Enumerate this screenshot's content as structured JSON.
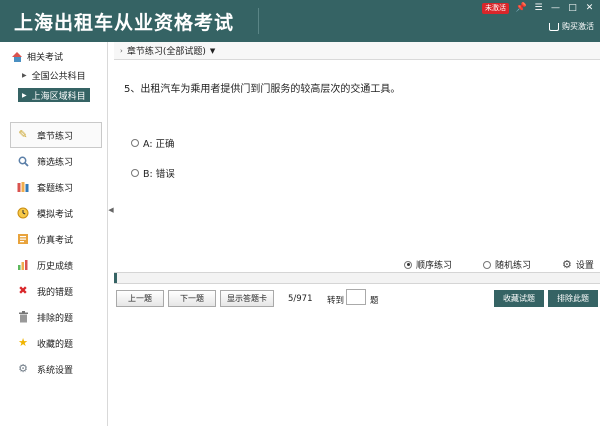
{
  "window": {
    "title": "上海出租车从业资格考试",
    "activate_badge": "未激活",
    "controls": {
      "pin": "📌",
      "menu": "☰",
      "minimize": "—",
      "maximize": "□",
      "close": "✕"
    },
    "buy_label": "购买激活"
  },
  "sidebar": {
    "root_label": "相关考试",
    "items": [
      {
        "label": "全国公共科目"
      },
      {
        "label": "上海区域科目"
      }
    ],
    "nav": [
      {
        "label": "章节练习",
        "icon": "pencil-icon"
      },
      {
        "label": "筛选练习",
        "icon": "magnifier-icon"
      },
      {
        "label": "套题练习",
        "icon": "books-icon"
      },
      {
        "label": "模拟考试",
        "icon": "clock-icon"
      },
      {
        "label": "仿真考试",
        "icon": "notebook-icon"
      },
      {
        "label": "历史成绩",
        "icon": "bar-chart-icon"
      },
      {
        "label": "我的错题",
        "icon": "red-x-icon"
      },
      {
        "label": "排除的题",
        "icon": "trash-icon"
      },
      {
        "label": "收藏的题",
        "icon": "star-icon"
      },
      {
        "label": "系统设置",
        "icon": "gear-icon"
      }
    ]
  },
  "main": {
    "chapter_selector": "章节练习(全部试题)",
    "question": "5、出租汽车为乘用者提供门到门服务的较高层次的交通工具。",
    "options": [
      {
        "label": "A: 正确"
      },
      {
        "label": "B: 错误"
      }
    ],
    "modes": {
      "sequential": "顺序练习",
      "random": "随机练习",
      "settings": "设置"
    },
    "progress": {
      "current": 5,
      "total": 971
    },
    "toolbar": {
      "prev": "上一题",
      "next": "下一题",
      "answer_card": "显示答题卡",
      "counter": "5/971",
      "goto_prefix": "转到",
      "goto_suffix": "题",
      "goto_value": "",
      "favorite": "收藏试题",
      "exclude": "排除此题"
    }
  },
  "colors": {
    "accent": "#356364",
    "badge": "#d9262a"
  }
}
